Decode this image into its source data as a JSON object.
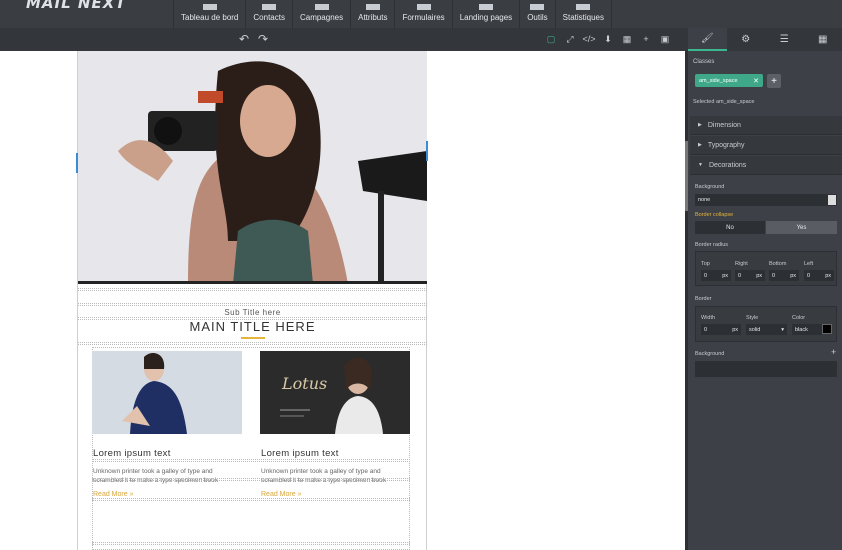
{
  "app": {
    "logo": "MAIL NEXT"
  },
  "nav": [
    {
      "label": "Tableau de bord",
      "icon": "home-icon"
    },
    {
      "label": "Contacts",
      "icon": "contacts-icon"
    },
    {
      "label": "Campagnes",
      "icon": "envelope-icon"
    },
    {
      "label": "Attributs",
      "icon": "gear-icon"
    },
    {
      "label": "Formulaires",
      "icon": "form-icon"
    },
    {
      "label": "Landing pages",
      "icon": "monitor-icon"
    },
    {
      "label": "Outils",
      "icon": "tools-icon"
    },
    {
      "label": "Statistiques",
      "icon": "chart-icon"
    }
  ],
  "editor": {
    "undo": "↶",
    "redo": "↷",
    "tools": [
      {
        "name": "border-toggle-icon",
        "glyph": "▢"
      },
      {
        "name": "fullscreen-icon",
        "glyph": "⤢"
      },
      {
        "name": "code-icon",
        "glyph": "</>"
      },
      {
        "name": "import-icon",
        "glyph": "⬇"
      },
      {
        "name": "blocks-icon",
        "glyph": "▦"
      },
      {
        "name": "add-icon",
        "glyph": "+"
      },
      {
        "name": "save-icon",
        "glyph": "▣"
      }
    ]
  },
  "email": {
    "subtitle": "Sub Title here",
    "title": "MAIN TITLE HERE",
    "cards": [
      {
        "title": "Lorem ipsum text",
        "body": "Unknown printer took a galley of type and scrambled it to make a type specimen book",
        "link": "Read More »"
      },
      {
        "title": "Lorem ipsum text",
        "body": "Unknown printer took a galley of type and scrambled it to make a type specimen book",
        "link": "Read More »"
      }
    ],
    "lotus_text": "Lotus"
  },
  "panel": {
    "tabs": [
      "style-manager-icon",
      "settings-icon",
      "layers-icon",
      "blocks-icon"
    ],
    "classes_label": "Classes",
    "chip": "am_side_space",
    "chip_close": "✕",
    "add": "+",
    "selected_label": "Selected",
    "selected_value": "am_side_space",
    "sections": {
      "dimension": "Dimension",
      "typography": "Typography",
      "decorations": "Decorations"
    },
    "background_label": "Background",
    "background_value": "none",
    "border_collapse_label": "Border collapse",
    "border_collapse_no": "No",
    "border_collapse_yes": "Yes",
    "border_radius_label": "Border radius",
    "radius": {
      "top": "Top",
      "right": "Right",
      "bottom": "Bottom",
      "left": "Left",
      "value": "0",
      "unit": "px"
    },
    "border_label": "Border",
    "border": {
      "width_label": "Width",
      "style_label": "Style",
      "color_label": "Color",
      "width_value": "0",
      "width_unit": "px",
      "style_value": "solid",
      "color_value": "black"
    },
    "background2_label": "Background",
    "background2_add": "+"
  },
  "colors": {
    "accent": "#3bb78f",
    "gold": "#e5b43a",
    "panel": "#3d4046"
  }
}
